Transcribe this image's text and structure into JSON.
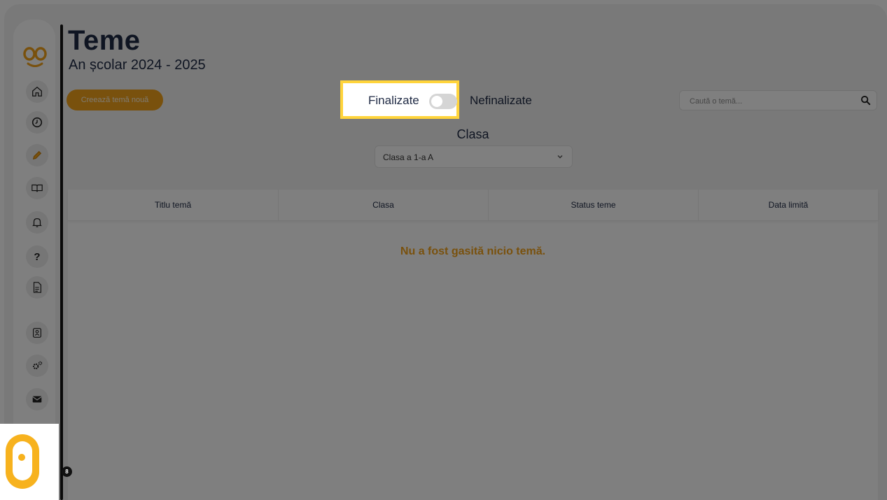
{
  "header": {
    "title": "Teme",
    "school_year": "An școlar 2024 - 2025"
  },
  "toolbar": {
    "create_label": "Creează temă nouă",
    "toggle_left_label": "Finalizate",
    "toggle_right_label": "Nefinalizate",
    "toggle_on": false,
    "search_placeholder": "Caută o temă..."
  },
  "class_filter": {
    "label": "Clasa",
    "selected": "Clasa a 1-a A"
  },
  "table": {
    "columns": [
      "Titlu temă",
      "Clasa",
      "Status teme",
      "Data limită"
    ],
    "empty_message": "Nu a fost gasită nicio temă."
  },
  "sidebar": {
    "items": [
      {
        "icon": "home-icon"
      },
      {
        "icon": "clock-icon"
      },
      {
        "icon": "pencil-icon"
      },
      {
        "icon": "book-icon"
      },
      {
        "icon": "bell-icon"
      },
      {
        "icon": "help-icon",
        "glyph": "?"
      },
      {
        "icon": "document-icon"
      },
      {
        "icon": "contact-card-icon"
      },
      {
        "icon": "settings-gears-icon"
      },
      {
        "icon": "mail-icon"
      }
    ]
  },
  "badge": {
    "count": "8"
  },
  "colors": {
    "accent": "#f3a21b",
    "text_dark": "#1f2a44",
    "highlight_border": "#ffd43b"
  }
}
